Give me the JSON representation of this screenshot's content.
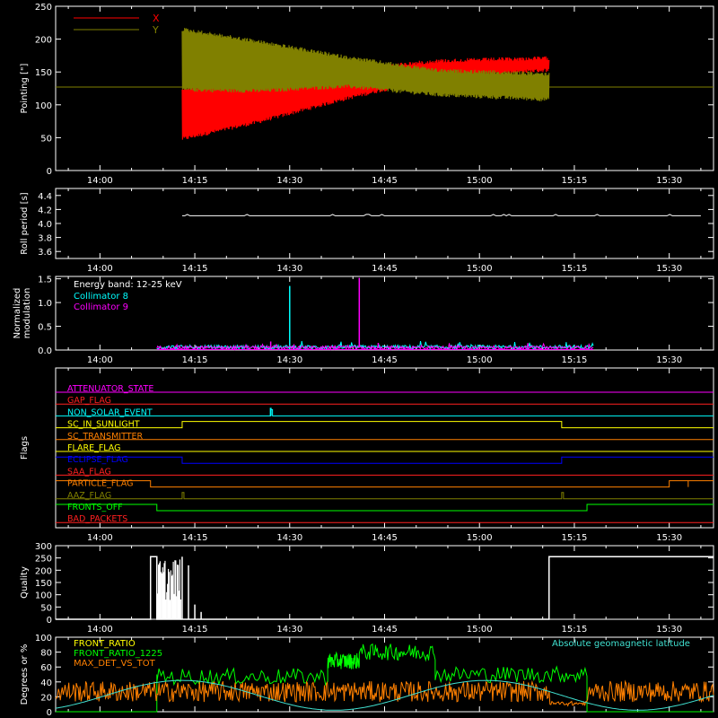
{
  "time_ticks": [
    "14:00",
    "14:15",
    "14:30",
    "14:45",
    "15:00",
    "15:15",
    "15:30"
  ],
  "colors": {
    "axis": "#ffffff",
    "x": "#ff0000",
    "y": "#808000",
    "cyan": "#00ffff",
    "magenta": "#ff00ff",
    "green": "#00ff00",
    "orange": "#ff8000",
    "yellow": "#ffff00",
    "red": "#ff2020",
    "blue": "#0000ff",
    "light_cyan": "#40e0d0"
  },
  "chart_data": [
    {
      "id": "pointing",
      "type": "line",
      "ylabel": "Pointing [\"]",
      "ylim": [
        0,
        250
      ],
      "yticks": [
        0,
        50,
        100,
        150,
        200,
        250
      ],
      "xlim": [
        "13:53",
        "15:37"
      ],
      "reference_line": 127,
      "series": [
        {
          "name": "X",
          "color_key": "x",
          "start": "14:13",
          "end": "15:11",
          "upper_envelope": [
            [
              0,
              127
            ],
            [
              0.2,
              143
            ],
            [
              0.45,
              157
            ],
            [
              0.7,
              170
            ],
            [
              1,
              174
            ]
          ],
          "lower_envelope": [
            [
              0,
              45
            ],
            [
              0.2,
              70
            ],
            [
              0.45,
              107
            ],
            [
              0.7,
              140
            ],
            [
              1,
              150
            ]
          ]
        },
        {
          "name": "Y",
          "color_key": "y",
          "start": "14:13",
          "end": "15:11",
          "upper_envelope": [
            [
              0,
              218
            ],
            [
              0.2,
              200
            ],
            [
              0.45,
              175
            ],
            [
              0.7,
              155
            ],
            [
              1,
              150
            ]
          ],
          "lower_envelope": [
            [
              0,
              120
            ],
            [
              0.2,
              118
            ],
            [
              0.45,
              125
            ],
            [
              0.7,
              112
            ],
            [
              1,
              105
            ]
          ]
        }
      ]
    },
    {
      "id": "roll",
      "type": "line",
      "ylabel": "Roll period [s]",
      "ylim": [
        3.5,
        4.5
      ],
      "yticks": [
        3.6,
        3.8,
        4.0,
        4.2,
        4.4
      ],
      "series": [
        {
          "name": "Roll period",
          "color_key": "axis",
          "start": "14:13",
          "end": "15:35",
          "value": 4.11
        }
      ]
    },
    {
      "id": "modulation",
      "type": "line",
      "ylabel": [
        "Normalized",
        "modulation"
      ],
      "ylim": [
        0,
        1.55
      ],
      "yticks": [
        0.0,
        0.5,
        1.0,
        1.5
      ],
      "annotation": "Energy band: 12-25 keV",
      "series": [
        {
          "name": "Collimator 8",
          "color_key": "cyan",
          "start": "14:09",
          "end": "15:18",
          "baseline": 0.06,
          "spikes": [
            [
              "14:30",
              1.35
            ],
            [
              "14:38",
              0.12
            ]
          ]
        },
        {
          "name": "Collimator 9",
          "color_key": "magenta",
          "start": "14:09",
          "end": "15:18",
          "baseline": 0.05,
          "spikes": [
            [
              "14:41",
              1.52
            ],
            [
              "14:27",
              0.18
            ],
            [
              "14:44",
              0.15
            ]
          ]
        }
      ]
    },
    {
      "id": "flags",
      "type": "line",
      "ylabel": "Flags",
      "flags": [
        {
          "name": "ATTENUATOR_STATE",
          "color_key": "magenta",
          "level_low": true,
          "pulses": []
        },
        {
          "name": "GAP_FLAG",
          "color_key": "red",
          "pulses": []
        },
        {
          "name": "NON_SOLAR_EVENT",
          "color_key": "cyan",
          "pulses": [
            [
              "14:27",
              "14:27"
            ]
          ]
        },
        {
          "name": "SC_IN_SUNLIGHT",
          "color_key": "yellow",
          "pulses": [
            [
              "14:13",
              "15:13"
            ]
          ]
        },
        {
          "name": "SC_TRANSMITTER",
          "color_key": "orange",
          "pulses": []
        },
        {
          "name": "FLARE_FLAG",
          "color_key": "yellow",
          "pulses": []
        },
        {
          "name": "ECLIPSE_FLAG",
          "color_key": "blue",
          "pulses": [
            [
              "13:53",
              "14:13"
            ],
            [
              "15:13",
              "15:37"
            ]
          ]
        },
        {
          "name": "SAA_FLAG",
          "color_key": "red",
          "pulses": []
        },
        {
          "name": "PARTICLE_FLAG",
          "color_key": "orange",
          "pulses": [
            [
              "13:53",
              "14:08"
            ],
            [
              "15:30",
              "15:37"
            ]
          ]
        },
        {
          "name": "AAZ_FLAG",
          "color_key": "y",
          "pulses": [
            [
              "14:13",
              "14:13"
            ],
            [
              "15:13",
              "15:13"
            ]
          ]
        },
        {
          "name": "FRONTS_OFF",
          "color_key": "green",
          "pulses": [
            [
              "13:53",
              "14:09"
            ],
            [
              "15:17",
              "15:37"
            ]
          ]
        },
        {
          "name": "BAD_PACKETS",
          "color_key": "red",
          "pulses": []
        }
      ]
    },
    {
      "id": "quality",
      "type": "line",
      "ylabel": "Quality",
      "ylim": [
        0,
        300
      ],
      "yticks": [
        0,
        50,
        100,
        150,
        200,
        250,
        300
      ],
      "series": [
        {
          "name": "Quality",
          "color_key": "axis",
          "segments": [
            [
              "13:53",
              "14:08",
              0
            ],
            [
              "14:08",
              "14:09",
              255
            ],
            [
              "14:09",
              "15:11",
              0
            ],
            [
              "15:11",
              "15:37",
              255
            ]
          ],
          "spikes": [
            [
              "14:13",
              255
            ],
            [
              "14:14",
              220
            ],
            [
              "14:15",
              60
            ],
            [
              "14:16",
              30
            ]
          ]
        }
      ]
    },
    {
      "id": "ratios",
      "type": "line",
      "ylabel": "Degrees or %",
      "ylim": [
        0,
        100
      ],
      "yticks": [
        0,
        20,
        40,
        60,
        80,
        100
      ],
      "annotation": "Absolute geomagnetic latitude",
      "series": [
        {
          "name": "FRONT_RATIO",
          "color_key": "yellow"
        },
        {
          "name": "FRONT_RATIO_1225",
          "color_key": "green",
          "segments": [
            [
              "14:09",
              "14:36",
              47
            ],
            [
              "14:36",
              "14:41",
              68
            ],
            [
              "14:41",
              "14:53",
              80
            ],
            [
              "14:53",
              "15:17",
              50
            ]
          ]
        },
        {
          "name": "MAX_DET_VS_TOT",
          "color_key": "orange",
          "level": 27
        },
        {
          "name": "Absolute geomagnetic latitude",
          "color_key": "light_cyan",
          "sine": {
            "mid": 22,
            "amp": 20,
            "period_min": 48,
            "phase_min": 8
          }
        }
      ]
    }
  ]
}
